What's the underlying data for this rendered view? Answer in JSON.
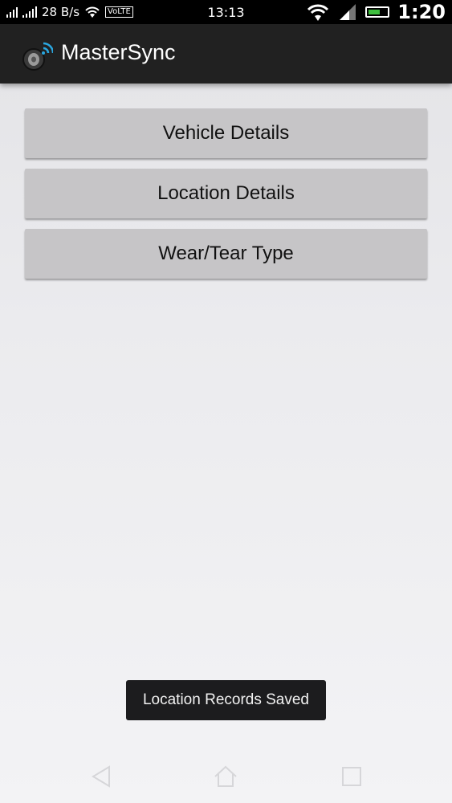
{
  "status_bar": {
    "net_speed": "28 B/s",
    "volte": "VoLTE",
    "time": "13:13",
    "clock_overlay": "1:20"
  },
  "app_bar": {
    "title": "MasterSync",
    "icon": "tire-wifi-app-icon"
  },
  "menu": {
    "buttons": [
      {
        "label": "Vehicle Details"
      },
      {
        "label": "Location Details"
      },
      {
        "label": "Wear/Tear Type"
      }
    ]
  },
  "toast": {
    "message": "Location Records Saved"
  },
  "nav_bar": {
    "icons": [
      "back-icon",
      "home-icon",
      "recents-icon"
    ]
  },
  "colors": {
    "app_bar": "#212121",
    "button": "#c6c5c7",
    "toast": "#1c1c1e"
  }
}
